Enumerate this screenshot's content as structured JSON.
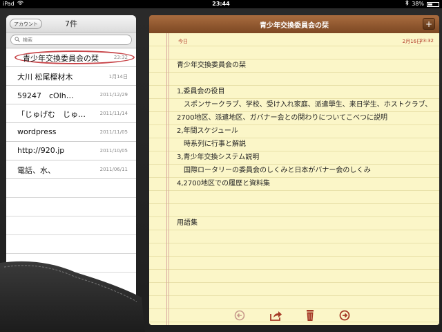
{
  "status": {
    "device": "iPad",
    "time": "23:44",
    "battery": "38%"
  },
  "sidebar": {
    "account_button": "アカウント",
    "count": "7件",
    "search_placeholder": "検索",
    "notes": [
      {
        "title": "青少年交換委員会の栞",
        "date": "23:32",
        "selected": true
      },
      {
        "title": "大川 松尾樫材木",
        "date": "1月14日"
      },
      {
        "title": "59247　cOlh…",
        "date": "2011/12/29"
      },
      {
        "title": "「じゅげむ　じゅ…",
        "date": "2011/11/14"
      },
      {
        "title": "wordpress",
        "date": "2011/11/05"
      },
      {
        "title": "http://920.jp",
        "date": "2011/10/05"
      },
      {
        "title": "電話、水、",
        "date": "2011/06/11"
      }
    ]
  },
  "note": {
    "title": "青少年交換委員会の栞",
    "add_label": "+",
    "today_label": "今日",
    "date": "2月16日",
    "time": "23:32",
    "lines": [
      "青少年交換委員会の栞",
      "",
      "1,委員会の役目",
      "　スポンサークラブ、学校、受け入れ家庭、派遣學生、来日学生、ホストクラブ、2700地区、派遣地区、ガバナー会との関わりについてこべつに説明",
      " 2,年間スケジュール",
      "　時系列に行事と解説",
      "3,青少年交換システム説明",
      "　国際ロータリーの委員会のしくみと日本がバナー会のしくみ",
      "4,2700地区での履歴と資料集",
      "",
      "",
      "用語集"
    ]
  },
  "toolbar": {
    "icons": [
      "back-arrow-icon",
      "share-icon",
      "trash-icon",
      "forward-arrow-icon"
    ]
  },
  "colors": {
    "accent_brown": "#8a5430",
    "paper": "#fbf6c8",
    "date_red": "#b23a2a",
    "selection_circle": "#c8464a"
  }
}
